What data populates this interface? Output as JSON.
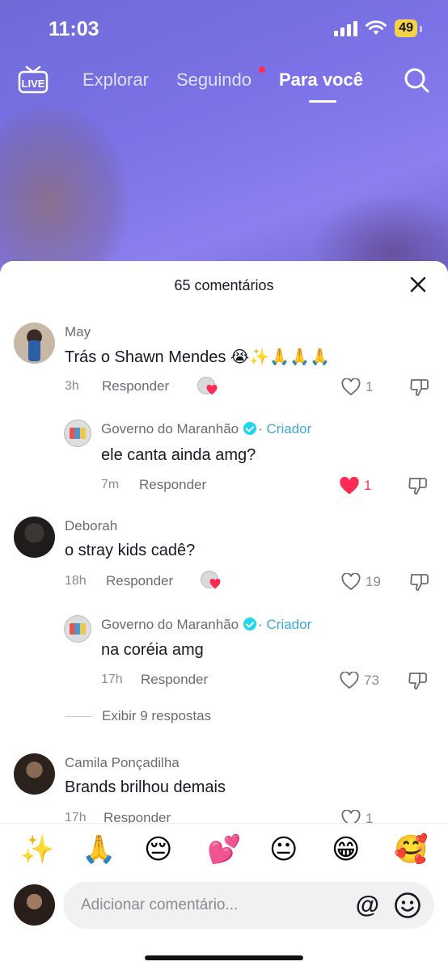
{
  "status_bar": {
    "time": "11:03",
    "battery": "49"
  },
  "top_nav": {
    "live_label": "LIVE",
    "tabs": [
      {
        "label": "Explorar"
      },
      {
        "label": "Seguindo"
      },
      {
        "label": "Para você"
      }
    ]
  },
  "sheet": {
    "title": "65 comentários"
  },
  "comments": [
    {
      "user": "May",
      "text": "Trás o Shawn Mendes 😭✨🙏🙏🙏",
      "time": "3h",
      "reply": "Responder",
      "likes": "1"
    },
    {
      "user": "Governo do Maranhão",
      "creator_tag": "Criador",
      "separator": "·",
      "text": "ele canta ainda amg?",
      "time": "7m",
      "reply": "Responder",
      "likes": "1",
      "liked": true
    },
    {
      "user": "Deborah",
      "text": "o stray kids cadê?",
      "time": "18h",
      "reply": "Responder",
      "likes": "19"
    },
    {
      "user": "Governo do Maranhão",
      "creator_tag": "Criador",
      "separator": "·",
      "text": "na coréia amg",
      "time": "17h",
      "reply": "Responder",
      "likes": "73"
    },
    {
      "view_more": "Exibir 9 respostas"
    },
    {
      "user": "Camila Ponçadilha",
      "text": "Brands brilhou demais",
      "time": "17h",
      "reply": "Responder",
      "likes": "1"
    }
  ],
  "emoji_bar": [
    "✨",
    "🙏",
    "😔",
    "💕",
    "😐",
    "😁",
    "🥰"
  ],
  "composer": {
    "placeholder": "Adicionar comentário...",
    "at_symbol": "@"
  },
  "colors": {
    "accent": "#fe2c55",
    "creator": "#3aa9d8",
    "verified": "#20d5ec"
  }
}
